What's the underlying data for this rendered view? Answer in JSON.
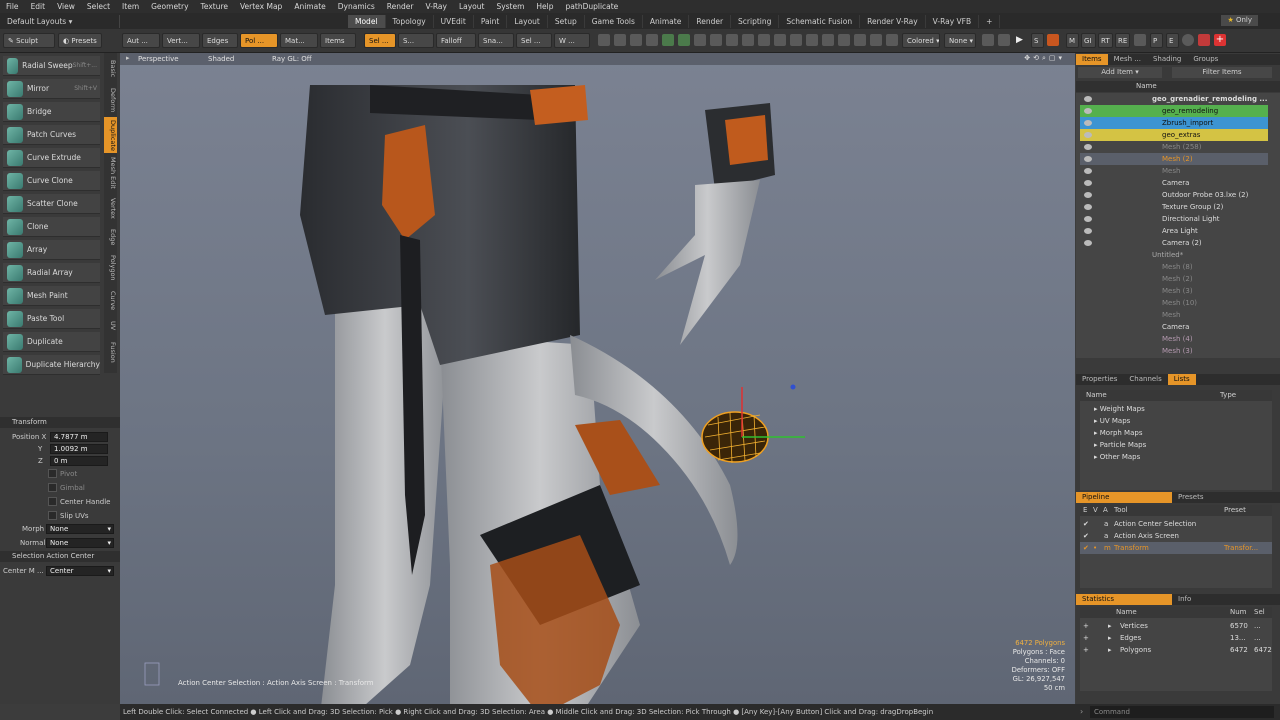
{
  "menu": [
    "File",
    "Edit",
    "View",
    "Select",
    "Item",
    "Geometry",
    "Texture",
    "Vertex Map",
    "Animate",
    "Dynamics",
    "Render",
    "V-Ray",
    "Layout",
    "System",
    "Help",
    "pathDuplicate"
  ],
  "layout_selector": "Default Layouts",
  "layout_tabs": [
    "Model",
    "Topology",
    "UVEdit",
    "Paint",
    "Layout",
    "Setup",
    "Game Tools",
    "Animate",
    "Render",
    "Scripting",
    "Schematic Fusion",
    "Render V-Ray",
    "V-Ray VFB"
  ],
  "only_label": "Only",
  "toolbar": {
    "sculpt": "Sculpt",
    "presets": "Presets",
    "auto": "Aut ...",
    "vert": "Vert...",
    "edges": "Edges",
    "poly": "Pol ...",
    "mat": "Mat...",
    "items": "Items",
    "sel": "Sel ...",
    "s": "S...",
    "falloff": "Falloff",
    "snap": "Sna...",
    "sel2": "Sel ...",
    "w": "W ...",
    "colored": "Colored",
    "none": "None",
    "s_btn": "S",
    "m": "M",
    "gi": "GI",
    "rt": "RT",
    "re": "RE",
    "p": "P",
    "e": "E"
  },
  "tools": [
    "Radial Sweep",
    "Mirror",
    "Bridge",
    "Patch Curves",
    "Curve Extrude",
    "Curve Clone",
    "Scatter Clone",
    "Clone",
    "Array",
    "Radial Array",
    "Mesh Paint",
    "Paste Tool",
    "Duplicate",
    "Duplicate Hierarchy"
  ],
  "shortcuts": {
    "radial_sweep": "Shift+...",
    "mirror": "Shift+V"
  },
  "vtabs": [
    "Basic",
    "Deform",
    "Duplicate",
    "Mesh Edit",
    "Vertex",
    "Edge",
    "Polygon",
    "Curve",
    "UV",
    "Fusion"
  ],
  "transform": {
    "title": "Transform",
    "position_label": "Position X",
    "y_label": "Y",
    "z_label": "Z",
    "x": "4.7877 m",
    "y": "1.0092 m",
    "z": "0 m",
    "pivot": "Pivot",
    "gimbal": "Gimbal",
    "center_handle": "Center Handle",
    "slip_uvs": "Slip UVs",
    "morph_label": "Morph",
    "morph": "None",
    "normal_label": "Normal",
    "normal": "None"
  },
  "action_center": {
    "title": "Selection Action Center",
    "label": "Center M ...",
    "value": "Center"
  },
  "viewport": {
    "perspective": "Perspective",
    "shaded": "Shaded",
    "raygl": "Ray GL: Off",
    "action_text": "Action Center Selection : Action Axis Screen : Transform"
  },
  "hud": {
    "polys": "6472 Polygons",
    "mode": "Polygons : Face",
    "channels": "Channels: 0",
    "deformers": "Deformers: OFF",
    "gl": "GL: 26,927,547",
    "scale": "50 cm"
  },
  "items_panel": {
    "tabs": [
      "Items",
      "Mesh ...",
      "Shading",
      "Groups"
    ],
    "add_item": "Add Item",
    "filter": "Filter Items",
    "name_col": "Name",
    "rows": [
      {
        "label": "geo_grenadier_remodeling ..."
      },
      {
        "label": "geo_remodeling"
      },
      {
        "label": "Zbrush_import"
      },
      {
        "label": "geo_extras"
      },
      {
        "label": "Mesh",
        "count": "(258)"
      },
      {
        "label": "Mesh",
        "count": "(2)"
      },
      {
        "label": "Mesh"
      },
      {
        "label": "Camera"
      },
      {
        "label": "Outdoor Probe 03.lxe",
        "count": "(2)"
      },
      {
        "label": "Texture Group",
        "count": "(2)"
      },
      {
        "label": "Directional Light"
      },
      {
        "label": "Area Light"
      },
      {
        "label": "Camera",
        "count": "(2)"
      },
      {
        "label": "Untitled*"
      },
      {
        "label": "Mesh",
        "count": "(8)"
      },
      {
        "label": "Mesh",
        "count": "(2)"
      },
      {
        "label": "Mesh",
        "count": "(3)"
      },
      {
        "label": "Mesh",
        "count": "(10)"
      },
      {
        "label": "Mesh"
      },
      {
        "label": "Camera"
      },
      {
        "label": "Mesh",
        "count": "(4)"
      },
      {
        "label": "Mesh",
        "count": "(3)"
      }
    ]
  },
  "lists_panel": {
    "tabs": [
      "Properties",
      "Channels",
      "Lists"
    ],
    "name_col": "Name",
    "type_col": "Type",
    "rows": [
      "Weight Maps",
      "UV Maps",
      "Morph Maps",
      "Particle Maps",
      "Other Maps"
    ]
  },
  "pipeline": {
    "tabs": [
      "Pipeline",
      "Presets"
    ],
    "cols": [
      "E",
      "V",
      "A",
      "Tool",
      "Preset"
    ],
    "rows": [
      {
        "a": "a",
        "tool": "Action Center Selection",
        "preset": ""
      },
      {
        "a": "a",
        "tool": "Action Axis Screen",
        "preset": ""
      },
      {
        "a": "m",
        "tool": "Transform",
        "preset": "Transfor..."
      }
    ]
  },
  "stats": {
    "tabs": [
      "Statistics",
      "Info"
    ],
    "cols": [
      "Name",
      "Num",
      "Sel"
    ],
    "rows": [
      {
        "name": "Vertices",
        "num": "6570",
        "sel": "..."
      },
      {
        "name": "Edges",
        "num": "13...",
        "sel": "..."
      },
      {
        "name": "Polygons",
        "num": "6472",
        "sel": "6472"
      }
    ]
  },
  "statusbar": "Left Double Click: Select Connected ● Left Click and Drag: 3D Selection: Pick ● Right Click and Drag: 3D Selection: Area ● Middle Click and Drag: 3D Selection: Pick Through ● [Any Key]-[Any Button] Click and Drag: dragDropBegin",
  "command": "Command",
  "colors": {
    "accent": "#e69528",
    "green": "#5fbf5a",
    "blue": "#3f9ad8",
    "yellow": "#d8c84a"
  }
}
